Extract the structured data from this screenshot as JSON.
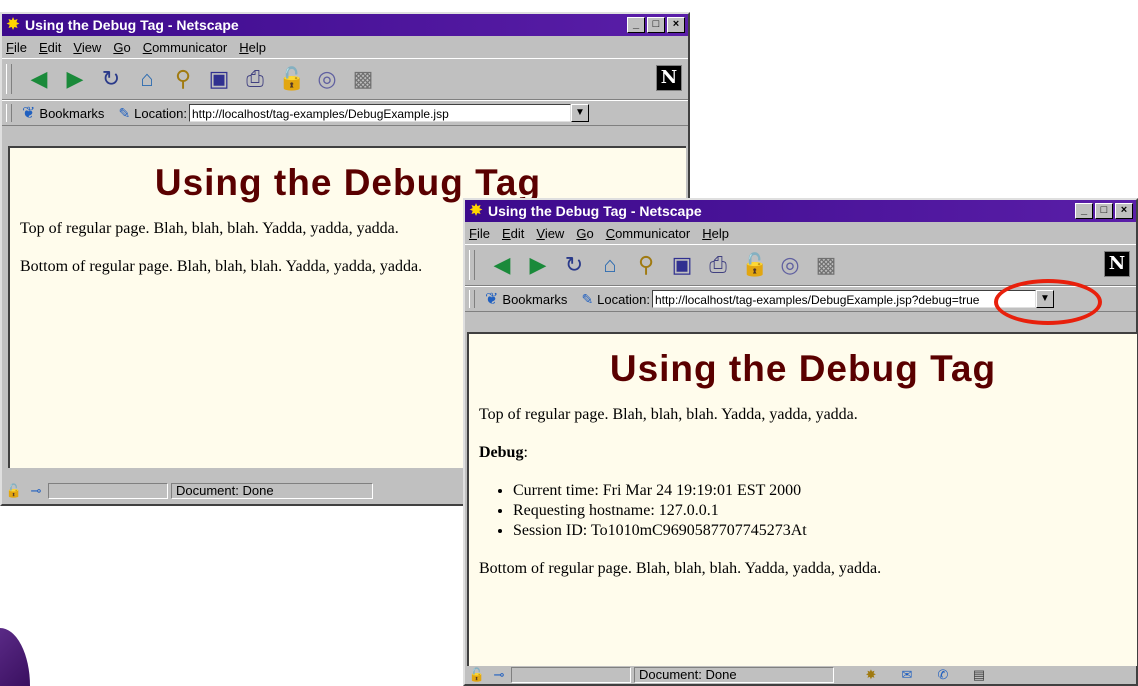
{
  "window": {
    "title": "Using the Debug Tag - Netscape",
    "menu": [
      "File",
      "Edit",
      "View",
      "Go",
      "Communicator",
      "Help"
    ],
    "bookmarks_label": "Bookmarks",
    "location_label": "Location:",
    "status": "Document: Done",
    "controls": [
      "_",
      "□",
      "×"
    ],
    "toolbar_icons": [
      "back-icon",
      "forward-icon",
      "reload-icon",
      "home-icon",
      "search-icon",
      "my-netscape-icon",
      "print-icon",
      "security-icon",
      "shop-icon",
      "stop-icon"
    ]
  },
  "back_window": {
    "url": "http://localhost/tag-examples/DebugExample.jsp",
    "heading": "Using the Debug Tag",
    "top_text": "Top of regular page. Blah, blah, blah. Yadda, yadda, yadda.",
    "bottom_text": "Bottom of regular page. Blah, blah, blah. Yadda, yadda, yadda."
  },
  "front_window": {
    "url": "http://localhost/tag-examples/DebugExample.jsp?debug=true",
    "heading": "Using the Debug Tag",
    "top_text": "Top of regular page. Blah, blah, blah. Yadda, yadda, yadda.",
    "debug_label": "Debug",
    "debug_items": [
      "Current time: Fri Mar 24 19:19:01 EST 2000",
      "Requesting hostname: 127.0.0.1",
      "Session ID: To1010mC9690587707745273At"
    ],
    "bottom_text": "Bottom of regular page. Blah, blah, blah. Yadda, yadda, yadda."
  },
  "colors": {
    "titlebar": "#3c0a8c",
    "heading": "#5a0000",
    "page_background": "#fffcec",
    "highlight_ring": "#e8200c"
  }
}
